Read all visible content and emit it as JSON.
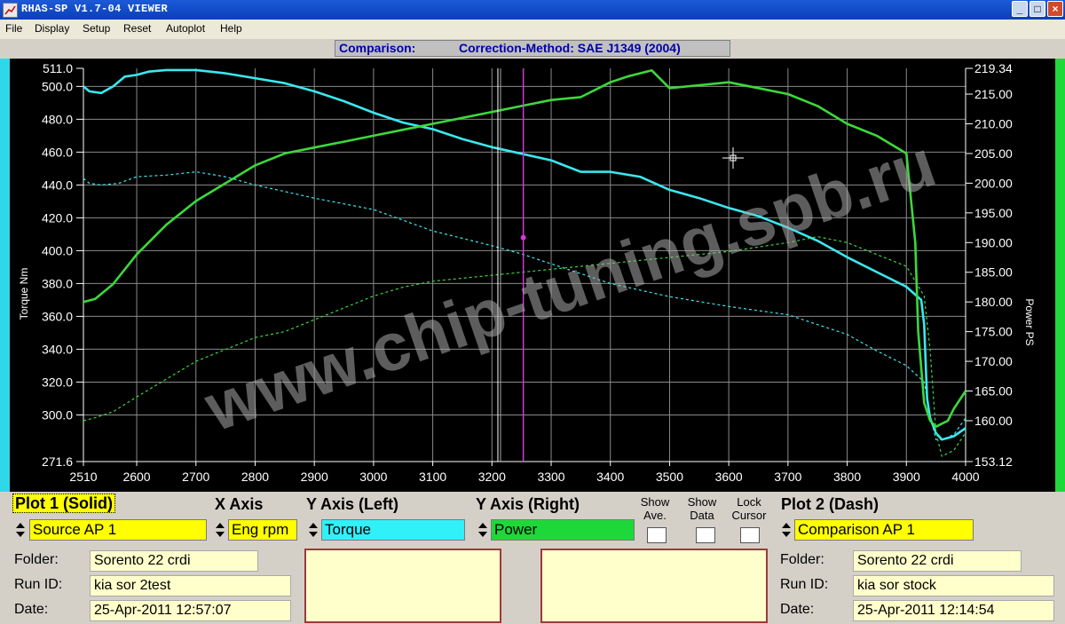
{
  "window": {
    "title": "RHAS-SP V1.7-04  VIEWER"
  },
  "menu": [
    "File",
    "Display",
    "Setup",
    "Reset",
    "Autoplot",
    "Help"
  ],
  "banner": {
    "label": "Comparison:",
    "method": "Correction-Method: SAE J1349 (2004)"
  },
  "chart_data": {
    "type": "line",
    "xlabel": "",
    "ylabel_left": "Torque Nm",
    "ylabel_right": "Power PS",
    "xlim": [
      2510,
      4000
    ],
    "ylim_left": [
      271.6,
      511.0
    ],
    "ylim_right": [
      153.12,
      219.34
    ],
    "grid": true,
    "x_ticks": [
      2510,
      2600,
      2700,
      2800,
      2900,
      3000,
      3100,
      3200,
      3300,
      3400,
      3500,
      3600,
      3700,
      3800,
      3900,
      4000
    ],
    "y_left_ticks": [
      "271.6",
      "300.0",
      "320.0",
      "340.0",
      "360.0",
      "380.0",
      "400.0",
      "420.0",
      "440.0",
      "460.0",
      "480.0",
      "500.0",
      "511.0"
    ],
    "y_right_ticks": [
      "153.12",
      "160.00",
      "165.00",
      "170.00",
      "175.00",
      "180.00",
      "185.00",
      "190.00",
      "195.00",
      "200.00",
      "205.00",
      "210.00",
      "215.00",
      "219.34"
    ],
    "cursor_rpm": 3210,
    "marker_rpm": 3253,
    "marker_torque": 408,
    "colors": {
      "torque": "#3ae8f0",
      "power": "#3cd83c",
      "cursor": "#ffffff",
      "marker": "#d23ad8"
    },
    "series": [
      {
        "name": "Torque",
        "axis": "left",
        "style": "solid",
        "x": [
          2510,
          2520,
          2540,
          2560,
          2580,
          2600,
          2620,
          2650,
          2700,
          2750,
          2800,
          2850,
          2900,
          2950,
          3000,
          3050,
          3100,
          3150,
          3200,
          3250,
          3300,
          3350,
          3400,
          3450,
          3500,
          3550,
          3600,
          3650,
          3700,
          3750,
          3800,
          3850,
          3900,
          3925,
          3930,
          3935,
          3940,
          3950,
          3960,
          3980,
          4000
        ],
        "y": [
          500,
          497,
          496,
          500,
          506,
          507,
          509,
          510,
          510,
          508,
          505,
          502,
          497,
          491,
          484,
          478,
          474,
          468,
          463,
          459,
          455,
          448,
          448,
          445,
          437,
          432,
          426,
          421,
          414,
          406,
          396,
          387,
          378,
          370,
          355,
          310,
          298,
          289,
          285,
          287,
          292
        ]
      },
      {
        "name": "Power",
        "axis": "right",
        "style": "solid",
        "x": [
          2510,
          2530,
          2560,
          2600,
          2650,
          2700,
          2750,
          2800,
          2850,
          2900,
          2950,
          3000,
          3050,
          3100,
          3150,
          3200,
          3250,
          3300,
          3350,
          3400,
          3430,
          3450,
          3470,
          3490,
          3500,
          3550,
          3600,
          3650,
          3700,
          3750,
          3800,
          3850,
          3900,
          3915,
          3920,
          3930,
          3940,
          3950,
          3960,
          3970,
          3980,
          4000
        ],
        "y": [
          180,
          180.5,
          183,
          188,
          193,
          197,
          200,
          203,
          205,
          206,
          207,
          208,
          209,
          210,
          211,
          212,
          213,
          214,
          214.5,
          217,
          218,
          218.5,
          219,
          217,
          216,
          216.5,
          217,
          216,
          215,
          213,
          210,
          208,
          205,
          190,
          175,
          163,
          160,
          159,
          159.5,
          160,
          162,
          165
        ]
      },
      {
        "name": "Comparison AP 1 Torque",
        "axis": "left",
        "style": "dashed",
        "x": [
          2510,
          2520,
          2540,
          2570,
          2600,
          2650,
          2700,
          2750,
          2800,
          2850,
          2900,
          3000,
          3100,
          3200,
          3250,
          3300,
          3400,
          3500,
          3600,
          3700,
          3800,
          3850,
          3900,
          3930,
          3940,
          3950,
          3960,
          3980,
          4000
        ],
        "y": [
          444,
          441,
          440,
          441,
          445,
          446,
          448,
          445,
          440,
          436,
          432,
          425,
          412,
          403,
          398,
          392,
          380,
          372,
          366,
          361,
          349,
          339,
          330,
          320,
          300,
          285,
          285,
          288,
          298
        ]
      },
      {
        "name": "Comparison AP 1 Power",
        "axis": "right",
        "style": "dashed",
        "x": [
          2510,
          2530,
          2560,
          2600,
          2650,
          2700,
          2750,
          2800,
          2850,
          2900,
          3000,
          3050,
          3100,
          3200,
          3300,
          3400,
          3500,
          3600,
          3700,
          3750,
          3800,
          3850,
          3900,
          3930,
          3940,
          3950,
          3960,
          3980,
          4000
        ],
        "y": [
          160,
          160.5,
          161.5,
          164,
          167,
          170,
          172,
          174,
          175,
          177,
          181,
          182.5,
          183.5,
          184.5,
          185.5,
          186.5,
          187.5,
          188.5,
          190,
          191,
          190,
          188,
          186,
          181,
          172,
          158,
          154,
          155,
          158
        ]
      }
    ]
  },
  "controls": {
    "plot1": {
      "header": "Plot 1 (Solid)",
      "source": "Source AP 1",
      "folder_label": "Folder:",
      "folder": "Sorento 22 crdi",
      "runid_label": "Run ID:",
      "runid": "kia sor 2test",
      "date_label": "Date:",
      "date": "25-Apr-2011  12:57:07"
    },
    "xaxis": {
      "header": "X Axis",
      "value": "Eng rpm"
    },
    "yleft": {
      "header": "Y Axis (Left)",
      "value": "Torque"
    },
    "yright": {
      "header": "Y Axis (Right)",
      "value": "Power"
    },
    "show_ave": "Show\nAve.",
    "show_data": "Show\nData",
    "lock_cursor": "Lock\nCursor",
    "plot2": {
      "header": "Plot 2 (Dash)",
      "source": "Comparison AP 1",
      "folder_label": "Folder:",
      "folder": "Sorento 22 crdi",
      "runid_label": "Run ID:",
      "runid": "kia sor stock",
      "date_label": "Date:",
      "date": "25-Apr-2011  12:14:54"
    }
  },
  "watermark": "www.chip-tuning.spb.ru"
}
